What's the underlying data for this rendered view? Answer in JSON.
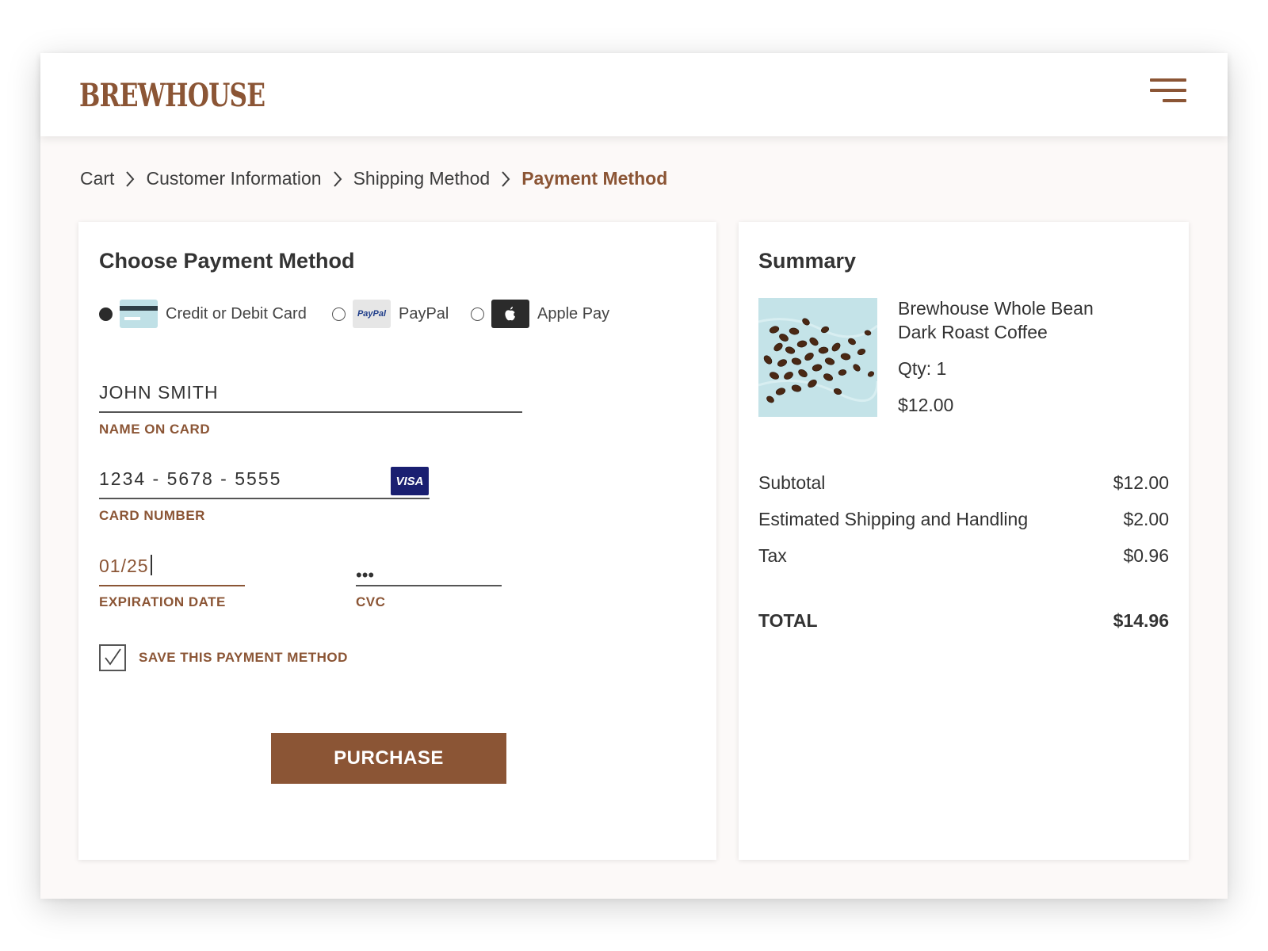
{
  "app": {
    "logo": "BREWHOUSE",
    "menu_icon": "hamburger-menu-icon"
  },
  "breadcrumb": {
    "items": [
      {
        "label": "Cart"
      },
      {
        "label": "Customer Information"
      },
      {
        "label": "Shipping Method"
      },
      {
        "label": "Payment Method"
      }
    ],
    "separator_icon": "chevron-right-icon",
    "active_index": 3
  },
  "payment": {
    "title": "Choose Payment Method",
    "methods": [
      {
        "label": "Credit or Debit Card",
        "selected": true,
        "icon": "credit-card-icon"
      },
      {
        "label": "PayPal",
        "selected": false,
        "icon": "paypal-icon",
        "icon_text": "PayPal"
      },
      {
        "label": "Apple Pay",
        "selected": false,
        "icon": "apple-icon"
      }
    ],
    "name_on_card": {
      "value": "JOHN SMITH",
      "label": "NAME ON CARD"
    },
    "card_number": {
      "value": "1234 - 5678 - 5555",
      "label": "CARD NUMBER",
      "brand": "VISA"
    },
    "expiration": {
      "value": "01/25",
      "label": "EXPIRATION DATE"
    },
    "cvc": {
      "value": "•••",
      "label": "CVC"
    },
    "save_method": {
      "label": "SAVE THIS PAYMENT METHOD",
      "checked": true
    },
    "purchase_label": "PURCHASE"
  },
  "summary": {
    "title": "Summary",
    "product": {
      "name_line1": "Brewhouse Whole Bean",
      "name_line2": "Dark Roast Coffee",
      "qty": "Qty: 1",
      "price": "$12.00"
    },
    "lines": [
      {
        "label": "Subtotal",
        "value": "$12.00"
      },
      {
        "label": "Estimated Shipping and Handling",
        "value": "$2.00"
      },
      {
        "label": "Tax",
        "value": "$0.96"
      }
    ],
    "total": {
      "label": "TOTAL",
      "value": "$14.96"
    }
  },
  "colors": {
    "brand": "#8b5535",
    "text": "#333333",
    "visa": "#1a1f71",
    "background": "#fcf9f8"
  }
}
